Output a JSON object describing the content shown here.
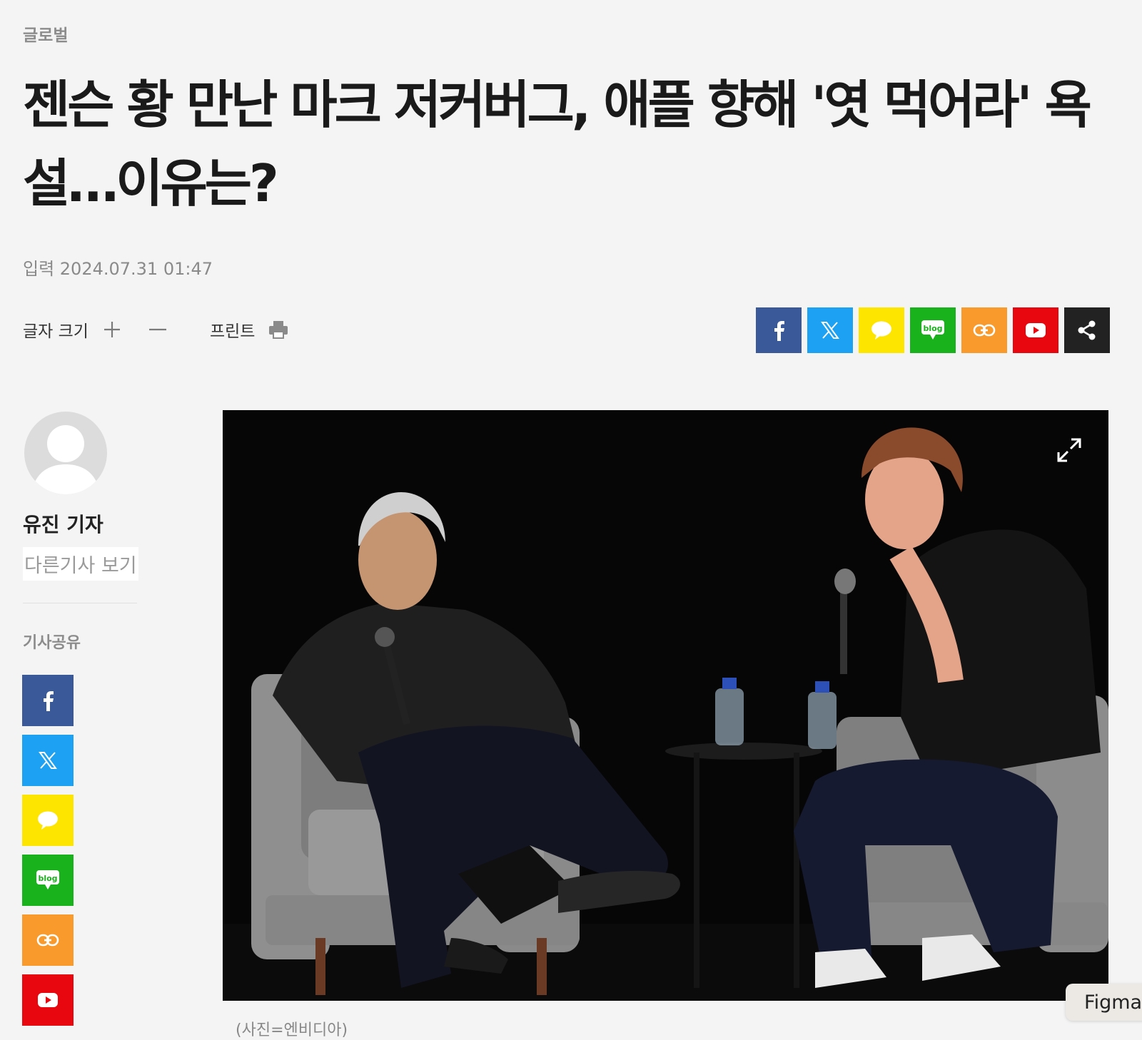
{
  "category": "글로벌",
  "headline": "젠슨 황 만난 마크 저커버그, 애플 향해 '엿 먹어라' 욕설…이유는?",
  "date": "입력 2024.07.31 01:47",
  "toolbar": {
    "font_size_label": "글자 크기",
    "print_label": "프린트"
  },
  "reporter": {
    "name": "유진 기자",
    "more_link": "다른기사 보기"
  },
  "share_label": "기사공유",
  "share_icons": {
    "facebook": "facebook-icon",
    "x": "x-icon",
    "kakaotalk": "kakaotalk-icon",
    "blog_text": "blog",
    "link": "link-icon",
    "youtube": "youtube-icon",
    "share": "share-icon"
  },
  "colors": {
    "facebook": "#3a5998",
    "x": "#1da1f2",
    "kakaotalk": "#fee500",
    "blog": "#19b21c",
    "link": "#f99b2c",
    "youtube": "#e8070e",
    "share": "#222222"
  },
  "caption": "(사진=엔비디아)",
  "figma_badge": "Figma"
}
